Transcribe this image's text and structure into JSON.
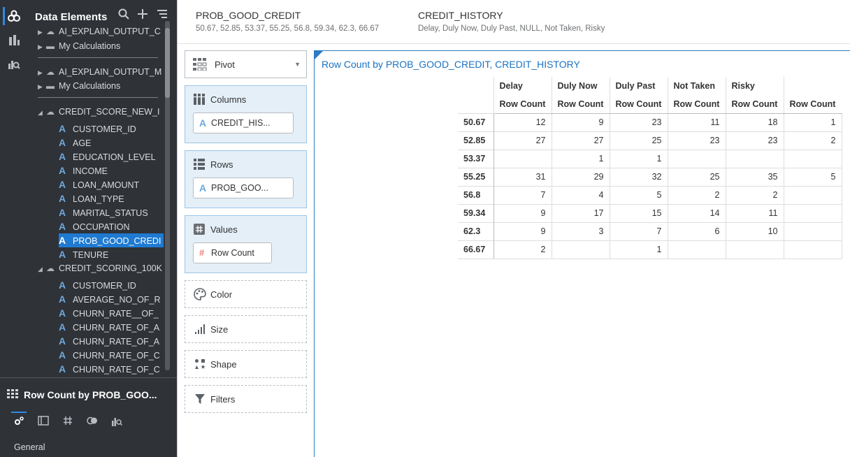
{
  "data_panel": {
    "title": "Data Elements",
    "tree": [
      {
        "label": "AI_EXPLAIN_OUTPUT_C",
        "kind": "source"
      },
      {
        "label": "My Calculations",
        "kind": "folder"
      },
      {
        "label": "AI_EXPLAIN_OUTPUT_M",
        "kind": "source"
      },
      {
        "label": "My Calculations",
        "kind": "folder"
      },
      {
        "label": "CREDIT_SCORE_NEW_I",
        "kind": "dataset"
      },
      {
        "label": "CUSTOMER_ID",
        "kind": "attr"
      },
      {
        "label": "AGE",
        "kind": "attr"
      },
      {
        "label": "EDUCATION_LEVEL",
        "kind": "attr"
      },
      {
        "label": "INCOME",
        "kind": "attr"
      },
      {
        "label": "LOAN_AMOUNT",
        "kind": "attr"
      },
      {
        "label": "LOAN_TYPE",
        "kind": "attr"
      },
      {
        "label": "MARITAL_STATUS",
        "kind": "attr"
      },
      {
        "label": "OCCUPATION",
        "kind": "attr"
      },
      {
        "label": "PROB_GOOD_CREDI",
        "kind": "attr",
        "selected": true
      },
      {
        "label": "TENURE",
        "kind": "attr"
      },
      {
        "label": "CREDIT_SCORING_100K",
        "kind": "dataset"
      },
      {
        "label": "CUSTOMER_ID",
        "kind": "attr"
      },
      {
        "label": "AVERAGE_NO_OF_R",
        "kind": "attr"
      },
      {
        "label": "CHURN_RATE__OF_",
        "kind": "attr"
      },
      {
        "label": "CHURN_RATE_OF_A",
        "kind": "attr"
      },
      {
        "label": "CHURN_RATE_OF_A",
        "kind": "attr"
      },
      {
        "label": "CHURN_RATE_OF_C",
        "kind": "attr"
      },
      {
        "label": "CHURN_RATE_OF_C",
        "kind": "attr"
      }
    ]
  },
  "properties": {
    "viz_title": "Row Count by PROB_GOO...",
    "section": "General"
  },
  "filters": [
    {
      "name": "PROB_GOOD_CREDIT",
      "values": "50.67, 52.85, 53.37, 55.25, 56.8, 59.34, 62.3, 66.67"
    },
    {
      "name": "CREDIT_HISTORY",
      "values": "Delay, Duly Now, Duly Past, NULL, Not Taken, Risky"
    }
  ],
  "grammar": {
    "viz_type": "Pivot",
    "columns_label": "Columns",
    "columns_pill": "CREDIT_HIS...",
    "rows_label": "Rows",
    "rows_pill": "PROB_GOO...",
    "values_label": "Values",
    "values_pill": "Row Count",
    "color": "Color",
    "size": "Size",
    "shape": "Shape",
    "filters": "Filters"
  },
  "canvas": {
    "caption": "Row Count by PROB_GOOD_CREDIT, CREDIT_HISTORY"
  },
  "chart_data": {
    "type": "table",
    "title": "Row Count by PROB_GOOD_CREDIT, CREDIT_HISTORY",
    "columns": [
      "Delay",
      "Duly Now",
      "Duly Past",
      "Not Taken",
      "Risky",
      ""
    ],
    "measure": "Row Count",
    "rows": [
      {
        "label": "50.67",
        "values": [
          "12",
          "9",
          "23",
          "11",
          "18",
          "1"
        ]
      },
      {
        "label": "52.85",
        "values": [
          "27",
          "27",
          "25",
          "23",
          "23",
          "2"
        ]
      },
      {
        "label": "53.37",
        "values": [
          "",
          "1",
          "1",
          "",
          "",
          ""
        ]
      },
      {
        "label": "55.25",
        "values": [
          "31",
          "29",
          "32",
          "25",
          "35",
          "5"
        ]
      },
      {
        "label": "56.8",
        "values": [
          "7",
          "4",
          "5",
          "2",
          "2",
          ""
        ]
      },
      {
        "label": "59.34",
        "values": [
          "9",
          "17",
          "15",
          "14",
          "11",
          ""
        ]
      },
      {
        "label": "62.3",
        "values": [
          "9",
          "3",
          "7",
          "6",
          "10",
          ""
        ]
      },
      {
        "label": "66.67",
        "values": [
          "2",
          "",
          "1",
          "",
          "",
          ""
        ]
      }
    ]
  }
}
